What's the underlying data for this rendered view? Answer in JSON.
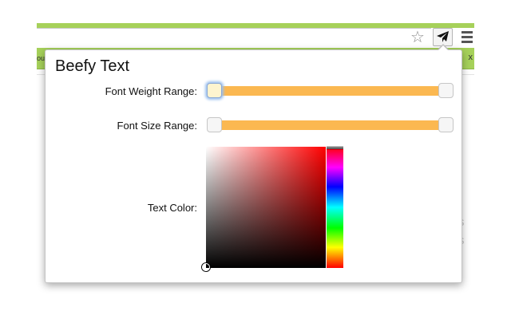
{
  "browser": {
    "bookmarks_left_fragment": "ou",
    "bookmarks_right_fragment": "x",
    "star_glyph": "☆",
    "background_fragments": [
      "s",
      "s"
    ]
  },
  "popup": {
    "title": "Beefy Text",
    "font_weight": {
      "label": "Font Weight Range:",
      "range_fraction": [
        0.0,
        1.0
      ]
    },
    "font_size": {
      "label": "Font Size Range:",
      "range_fraction": [
        0.0,
        1.0
      ]
    },
    "text_color": {
      "label": "Text Color:",
      "hue": "#ff0000",
      "selected_color": "#000000"
    }
  },
  "colors": {
    "toolbar_green": "#a6d15a",
    "slider_fill": "#fbb851",
    "handle_active_glow": "#9cc0ee"
  },
  "icons": {
    "extension": "paper-plane-icon",
    "menu": "hamburger-menu-icon",
    "bookmark": "star-icon"
  }
}
